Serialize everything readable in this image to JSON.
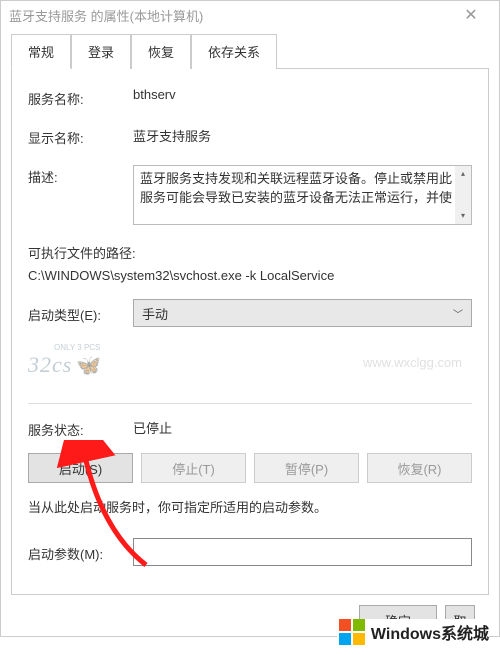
{
  "window": {
    "title": "蓝牙支持服务 的属性(本地计算机)"
  },
  "tabs": [
    "常规",
    "登录",
    "恢复",
    "依存关系"
  ],
  "fields": {
    "service_name_label": "服务名称:",
    "service_name_value": "bthserv",
    "display_name_label": "显示名称:",
    "display_name_value": "蓝牙支持服务",
    "description_label": "描述:",
    "description_value": "蓝牙服务支持发现和关联远程蓝牙设备。停止或禁用此服务可能会导致已安装的蓝牙设备无法正常运行，并使",
    "exe_path_label": "可执行文件的路径:",
    "exe_path_value": "C:\\WINDOWS\\system32\\svchost.exe -k LocalService",
    "startup_type_label": "启动类型(E):",
    "startup_type_value": "手动",
    "service_status_label": "服务状态:",
    "service_status_value": "已停止",
    "hint": "当从此处启动服务时，你可指定所适用的启动参数。",
    "start_params_label": "启动参数(M):",
    "start_params_value": ""
  },
  "buttons": {
    "start": "启动(S)",
    "stop": "停止(T)",
    "pause": "暂停(P)",
    "resume": "恢复(R)",
    "ok": "确定",
    "cancel": "取"
  },
  "watermark": {
    "small": "ONLY 3 PCS",
    "main": "32cs",
    "url": "www.wxclgg.com"
  },
  "footer_logo": "Windows系统城"
}
